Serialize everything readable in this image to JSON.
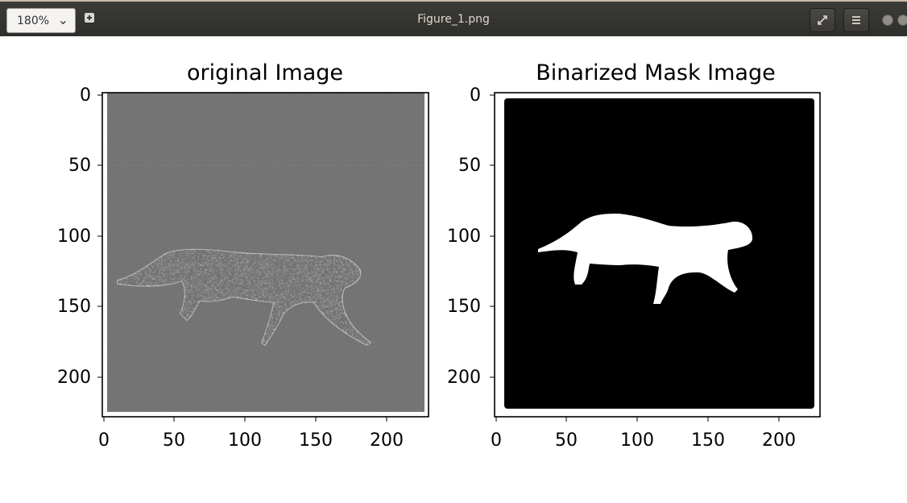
{
  "window": {
    "title": "Figure_1.png",
    "zoom": "180%"
  },
  "icons": {
    "zoom_dropdown": "chevron-down-icon",
    "new_tab": "plus-box-icon",
    "fullscreen": "fullscreen-arrows-icon",
    "menu": "hamburger-menu-icon",
    "minimize": "minimize-icon"
  },
  "figure": {
    "left": {
      "title": "original Image",
      "xticks": [
        "0",
        "50",
        "100",
        "150",
        "200"
      ],
      "yticks": [
        "0",
        "50",
        "100",
        "150",
        "200"
      ]
    },
    "right": {
      "title": "Binarized Mask Image",
      "xticks": [
        "0",
        "50",
        "100",
        "150",
        "200"
      ],
      "yticks": [
        "0",
        "50",
        "100",
        "150",
        "200"
      ]
    }
  }
}
